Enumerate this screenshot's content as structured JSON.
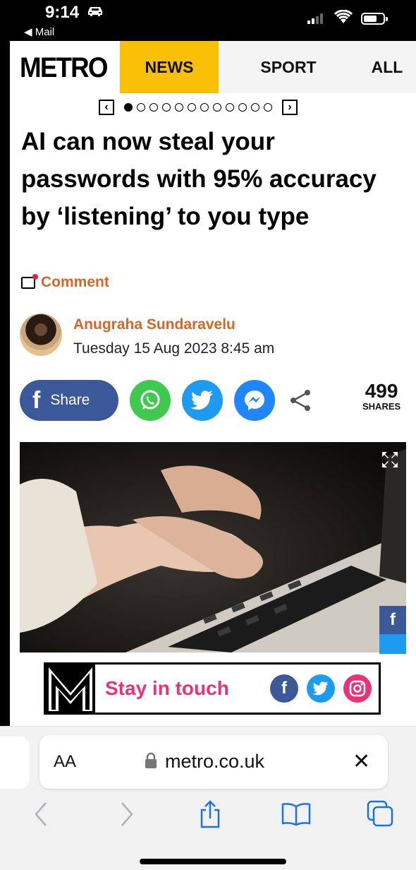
{
  "status_bar": {
    "time": "9:14",
    "back_app": "◀ Mail"
  },
  "nav": {
    "logo": "METRO",
    "tabs": [
      "NEWS",
      "SPORT",
      "ALL"
    ],
    "active_tab": "NEWS"
  },
  "carousel": {
    "total_dots": 12,
    "active_index": 0
  },
  "article": {
    "headline": "AI can now steal your passwords with 95% accuracy by ‘listening’ to you type",
    "comment_label": "Comment",
    "author": "Anugraha Sundaravelu",
    "date": "Tuesday 15 Aug 2023 8:45 am"
  },
  "share": {
    "facebook_label": "Share",
    "count": "499",
    "count_label": "SHARES"
  },
  "stay_in_touch": {
    "label": "Stay in touch"
  },
  "safari": {
    "aa_label": "AA",
    "url": "metro.co.uk"
  },
  "colors": {
    "news_tab": "#f9c006",
    "accent_orange": "#d4662a",
    "facebook": "#3b5998",
    "twitter": "#1d9bf0",
    "whatsapp": "#3fc94e",
    "messenger": "#1f86ff",
    "instagram_pink": "#e8337a"
  }
}
